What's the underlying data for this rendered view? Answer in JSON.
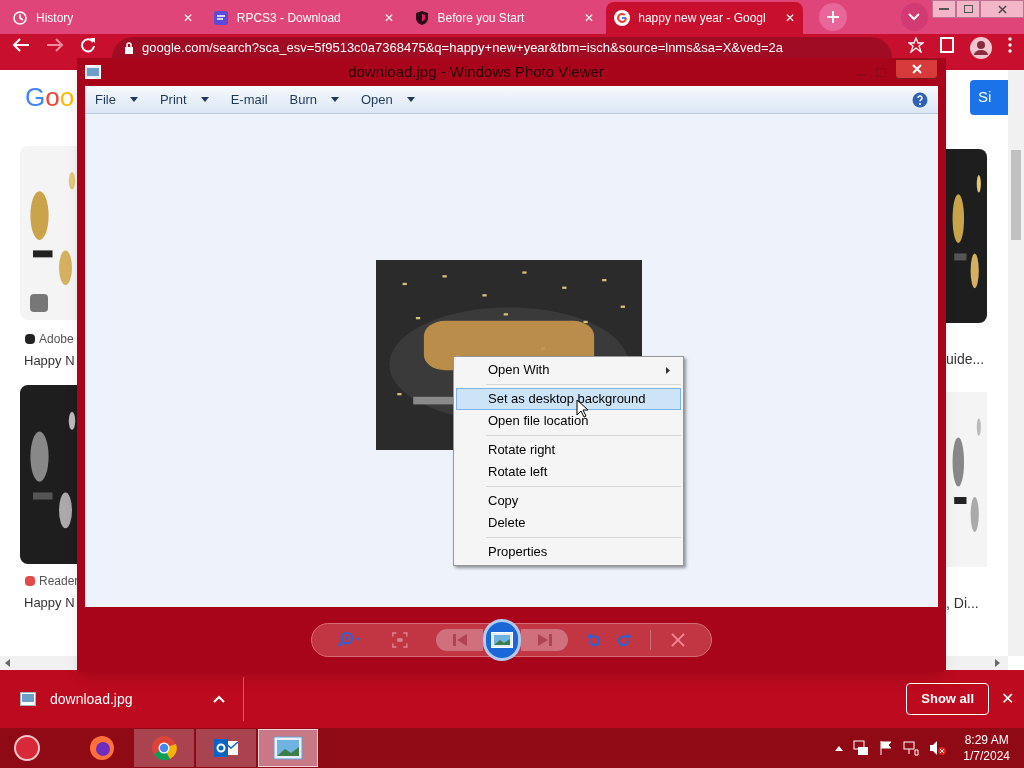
{
  "browser": {
    "tabs": [
      {
        "title": "History",
        "kind": "clock",
        "close": "✕",
        "selected": false
      },
      {
        "title": "RPCS3 - Download",
        "kind": "app",
        "close": "✕",
        "selected": false
      },
      {
        "title": "Before you Start",
        "kind": "shield",
        "close": "✕",
        "selected": false
      },
      {
        "title": "happy new year - Googl",
        "kind": "google",
        "close": "✕",
        "selected": true
      }
    ],
    "address": "google.com/search?sca_esv=5f9513c0a7368475&q=happy+new+year&tbm=isch&source=lnms&sa=X&ved=2a",
    "page": {
      "logo": "Goo",
      "button": "Si",
      "left_results": [
        {
          "source": "Adobe",
          "title": "Happy N"
        },
        {
          "source": "Reader",
          "title": "Happy N"
        }
      ],
      "right_results": [
        {
          "title": "uide..."
        },
        {
          "title": ", Di..."
        }
      ]
    },
    "download_bar": {
      "file": "download.jpg",
      "show_all": "Show all",
      "close": "✕"
    }
  },
  "photo_viewer": {
    "title": "download.jpg - Windows Photo Viewer",
    "menu": [
      {
        "label": "File",
        "dropdown": true
      },
      {
        "label": "Print",
        "dropdown": true
      },
      {
        "label": "E-mail",
        "dropdown": false
      },
      {
        "label": "Burn",
        "dropdown": true
      },
      {
        "label": "Open",
        "dropdown": true
      }
    ],
    "context_menu": [
      [
        {
          "label": "Open With",
          "submenu": true,
          "selected": false
        }
      ],
      [
        {
          "label": "Set as desktop background",
          "submenu": false,
          "selected": true
        },
        {
          "label": "Open file location",
          "submenu": false,
          "selected": false
        }
      ],
      [
        {
          "label": "Rotate right",
          "submenu": false,
          "selected": false
        },
        {
          "label": "Rotate left",
          "submenu": false,
          "selected": false
        }
      ],
      [
        {
          "label": "Copy",
          "submenu": false,
          "selected": false
        },
        {
          "label": "Delete",
          "submenu": false,
          "selected": false
        }
      ],
      [
        {
          "label": "Properties",
          "submenu": false,
          "selected": false
        }
      ]
    ]
  },
  "taskbar": {
    "apps": [
      {
        "kind": "firefox",
        "selected": false
      },
      {
        "kind": "chrome",
        "selected": false
      },
      {
        "kind": "mail",
        "selected": false
      },
      {
        "kind": "photos",
        "selected": true
      }
    ],
    "time": "8:29 AM",
    "date": "1/7/2024"
  }
}
